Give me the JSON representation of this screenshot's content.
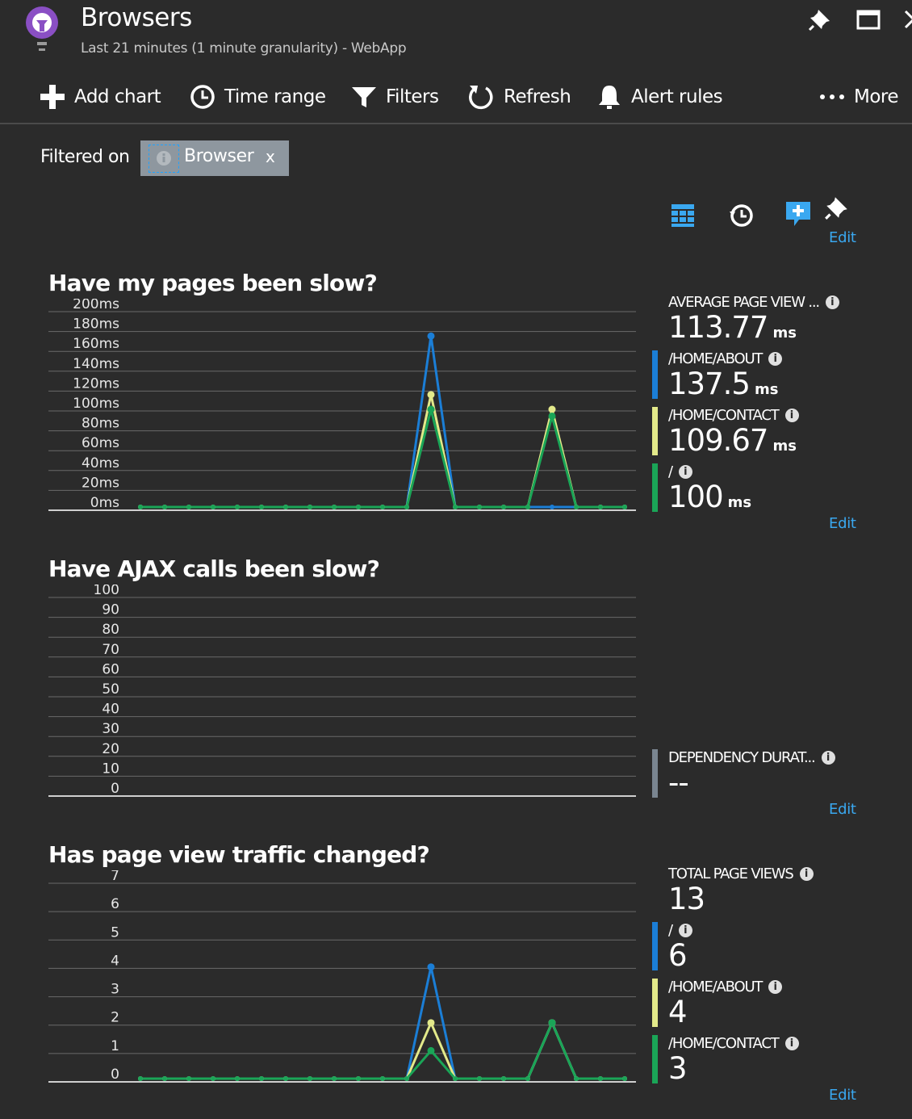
{
  "header": {
    "title": "Browsers",
    "subtitle": "Last 21 minutes (1 minute granularity) - WebApp"
  },
  "toolbar": {
    "add_chart": "Add chart",
    "time_range": "Time range",
    "filters": "Filters",
    "refresh": "Refresh",
    "alert_rules": "Alert rules",
    "more": "More"
  },
  "filter": {
    "label": "Filtered on",
    "chip_label": "Browser",
    "chip_remove": "x"
  },
  "edit_label": "Edit",
  "colors": {
    "background": "#2b2b2b",
    "series_blue": "#1b7ed6",
    "series_yellow": "#e3e98a",
    "series_green": "#1aa557",
    "dependency_gray": "#7a8590",
    "link": "#3aa8f0"
  },
  "charts": [
    {
      "title": "Have my pages been slow?",
      "metrics": [
        {
          "label": "AVERAGE PAGE VIEW ...",
          "value": "113.77",
          "unit": "ms"
        },
        {
          "label": "/HOME/ABOUT",
          "value": "137.5",
          "unit": "ms",
          "color": "#1b7ed6"
        },
        {
          "label": "/HOME/CONTACT",
          "value": "109.67",
          "unit": "ms",
          "color": "#e3e98a"
        },
        {
          "label": "/",
          "value": "100",
          "unit": "ms",
          "color": "#1aa557"
        }
      ]
    },
    {
      "title": "Have AJAX calls been slow?",
      "metrics": [
        {
          "label": "DEPENDENCY DURAT...",
          "value": "--",
          "unit": "",
          "color": "#7a8590"
        }
      ]
    },
    {
      "title": "Has page view traffic changed?",
      "metrics": [
        {
          "label": "TOTAL PAGE VIEWS",
          "value": "13",
          "unit": ""
        },
        {
          "label": "/",
          "value": "6",
          "unit": "",
          "color": "#1b7ed6"
        },
        {
          "label": "/HOME/ABOUT",
          "value": "4",
          "unit": "",
          "color": "#e3e98a"
        },
        {
          "label": "/HOME/CONTACT",
          "value": "3",
          "unit": "",
          "color": "#1aa557"
        }
      ]
    }
  ],
  "chart_data": [
    {
      "type": "line",
      "title": "Have my pages been slow?",
      "yticks": [
        "200ms",
        "180ms",
        "160ms",
        "140ms",
        "120ms",
        "100ms",
        "80ms",
        "60ms",
        "40ms",
        "20ms",
        "0ms"
      ],
      "ylim": [
        0,
        200
      ],
      "x": [
        1,
        2,
        3,
        4,
        5,
        6,
        7,
        8,
        9,
        10,
        11,
        12,
        13,
        14,
        15,
        16,
        17,
        18,
        19,
        20,
        21
      ],
      "grid": true,
      "series": [
        {
          "name": "/HOME/ABOUT",
          "color": "#1b7ed6",
          "values": [
            0,
            0,
            0,
            0,
            0,
            0,
            0,
            0,
            0,
            0,
            0,
            0,
            175,
            0,
            0,
            0,
            0,
            0,
            0,
            0,
            0
          ]
        },
        {
          "name": "/HOME/CONTACT",
          "color": "#e3e98a",
          "values": [
            0,
            0,
            0,
            0,
            0,
            0,
            0,
            0,
            0,
            0,
            0,
            0,
            115,
            0,
            0,
            0,
            0,
            100,
            0,
            0,
            0
          ]
        },
        {
          "name": "/",
          "color": "#1aa557",
          "values": [
            0,
            0,
            0,
            0,
            0,
            0,
            0,
            0,
            0,
            0,
            0,
            0,
            100,
            0,
            0,
            0,
            0,
            93,
            0,
            0,
            0
          ]
        }
      ]
    },
    {
      "type": "line",
      "title": "Have AJAX calls been slow?",
      "yticks": [
        "100",
        "90",
        "80",
        "70",
        "60",
        "50",
        "40",
        "30",
        "20",
        "10",
        "0"
      ],
      "ylim": [
        0,
        100
      ],
      "grid": true,
      "series": []
    },
    {
      "type": "line",
      "title": "Has page view traffic changed?",
      "yticks": [
        "7",
        "6",
        "5",
        "4",
        "3",
        "2",
        "1",
        "0"
      ],
      "ylim": [
        0,
        7
      ],
      "x": [
        1,
        2,
        3,
        4,
        5,
        6,
        7,
        8,
        9,
        10,
        11,
        12,
        13,
        14,
        15,
        16,
        17,
        18,
        19,
        20,
        21
      ],
      "grid": true,
      "series": [
        {
          "name": "/",
          "color": "#1b7ed6",
          "values": [
            0,
            0,
            0,
            0,
            0,
            0,
            0,
            0,
            0,
            0,
            0,
            0,
            4,
            0,
            0,
            0,
            0,
            2,
            0,
            0,
            0
          ]
        },
        {
          "name": "/HOME/ABOUT",
          "color": "#e3e98a",
          "values": [
            0,
            0,
            0,
            0,
            0,
            0,
            0,
            0,
            0,
            0,
            0,
            0,
            2,
            0,
            0,
            0,
            0,
            2,
            0,
            0,
            0
          ]
        },
        {
          "name": "/HOME/CONTACT",
          "color": "#1aa557",
          "values": [
            0,
            0,
            0,
            0,
            0,
            0,
            0,
            0,
            0,
            0,
            0,
            0,
            1,
            0,
            0,
            0,
            0,
            2,
            0,
            0,
            0
          ]
        }
      ]
    }
  ]
}
